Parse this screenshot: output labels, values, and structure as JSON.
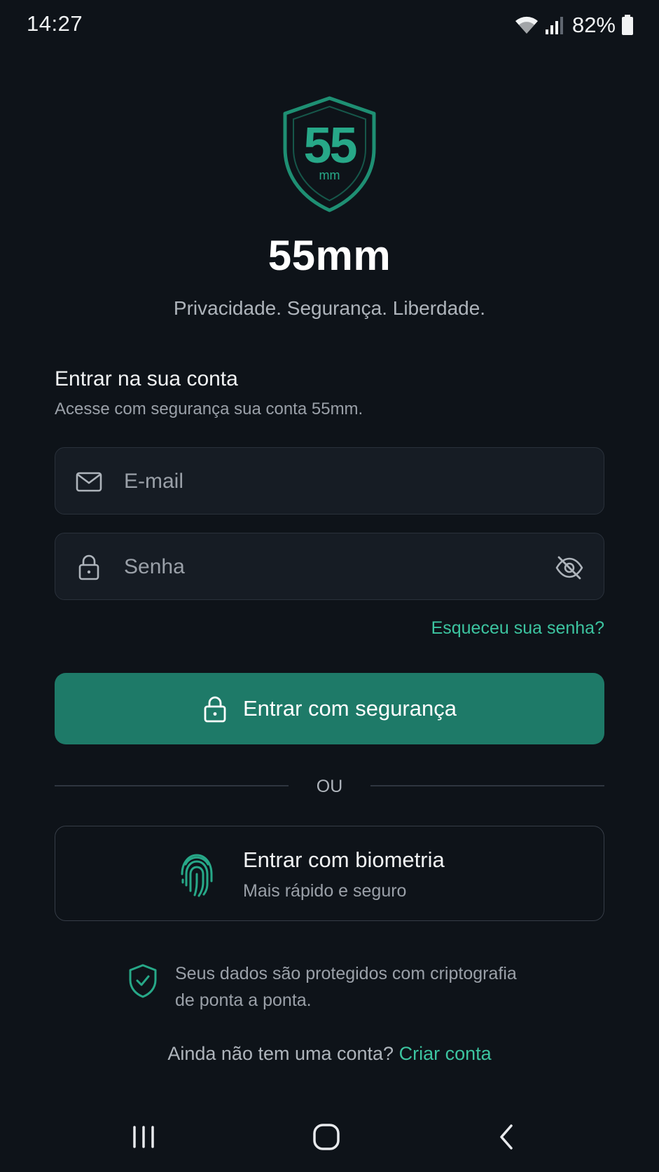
{
  "status_bar": {
    "time": "14:27",
    "battery": "82%"
  },
  "brand": {
    "logo_number": "55",
    "logo_unit": "mm",
    "app_name": "55mm",
    "tagline": "Privacidade. Segurança. Liberdade.",
    "accent_color": "#1e7a68",
    "link_color": "#3cc4a0"
  },
  "login": {
    "title": "Entrar na sua conta",
    "subtitle": "Acesse com segurança sua conta 55mm.",
    "email_placeholder": "E-mail",
    "password_placeholder": "Senha",
    "forgot_password": "Esqueceu sua senha?",
    "submit_label": "Entrar com segurança",
    "divider_text": "OU",
    "biometric_title": "Entrar com biometria",
    "biometric_subtitle": "Mais rápido e seguro"
  },
  "footer": {
    "security_note_line1": "Seus dados são protegidos com criptografia",
    "security_note_line2": "de ponta a ponta.",
    "signup_prompt": "Ainda não tem uma conta?",
    "signup_link": "Criar conta"
  },
  "icons": {
    "email": "envelope-icon",
    "password": "lock-icon",
    "visibility": "eye-off-icon",
    "biometric": "fingerprint-icon",
    "security": "shield-check-icon"
  }
}
